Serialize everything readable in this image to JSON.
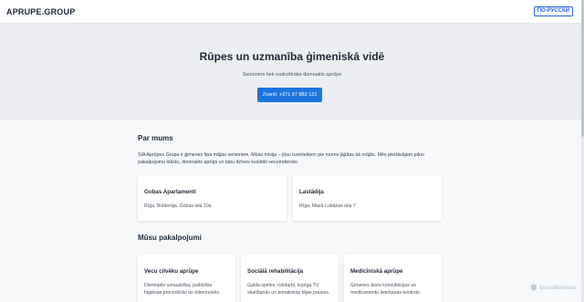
{
  "header": {
    "logo": "APRUPE.GROUP",
    "lang_button": "ПО-РУССКИ"
  },
  "hero": {
    "title": "Rūpes un uzmanība ģimeniskā vidē",
    "subtitle": "Senioriem tiek nodrošināta diennakts aprūpe",
    "call_button": "Zvanīt: +371 67 882 121"
  },
  "about": {
    "title": "Par mums",
    "text": "SIA Aprūpes Grupa ir ģimenes tipa mājas senioriem. Mūsu misija – jūsu tuviniekiem pie mums jājūtas kā mājās. Mēs piedāvājam pilnu pakalpojumu klāstu, diennakts aprūpi un labu dzīves kvalitāti vecumdienās."
  },
  "locations": [
    {
      "name": "Gobas Apartamenti",
      "address": "Rīga, Bolderāja, Gobas iela 10a"
    },
    {
      "name": "Lastādija",
      "address": "Rīga, Mazā Lubānas iela 7"
    }
  ],
  "services": {
    "title": "Mūsu pakalpojumi",
    "items": [
      {
        "name": "Vecu cilvēku aprūpe",
        "text": "Diennakts uzraudzība, palīdzība higiēnas procedūrās un ēdienreizēs."
      },
      {
        "name": "Sociālā rehabilitācija",
        "text": "Galda spēles, rokdarbi, kopīga TV skatīšanās un tematiskas tējas pauzes."
      },
      {
        "name": "Medicīniskā aprūpe",
        "text": "Ģimenes ārsta konsultācijas un medikamentu lietošanas kontrole."
      }
    ]
  },
  "watermark": "ScanMalware"
}
